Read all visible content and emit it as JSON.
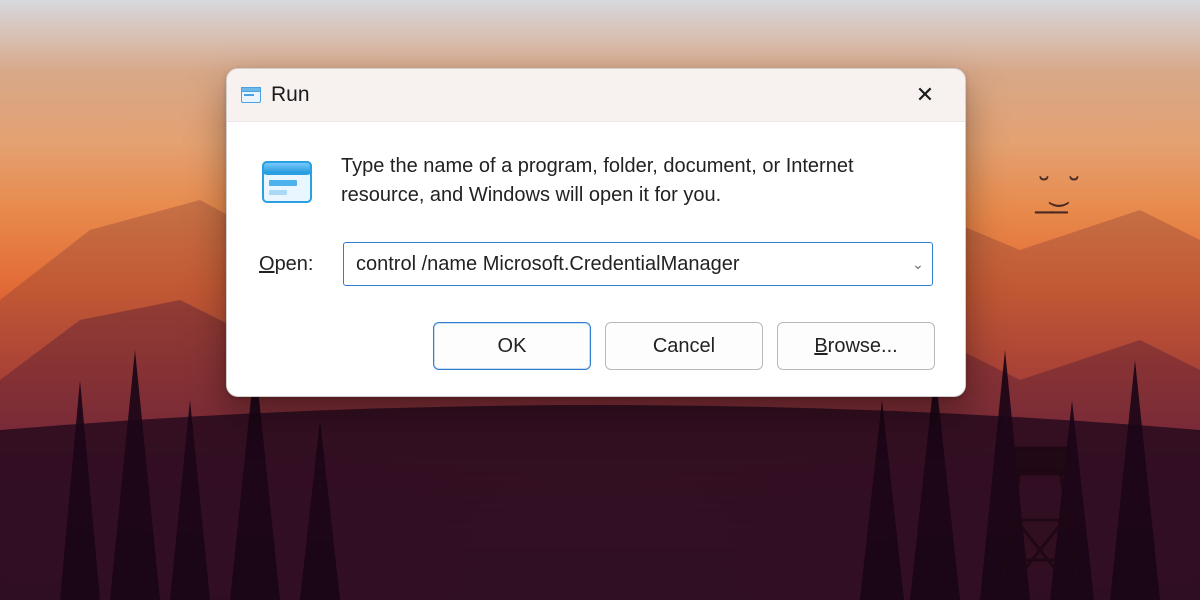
{
  "dialog": {
    "title": "Run",
    "description": "Type the name of a program, folder, document, or Internet resource, and Windows will open it for you.",
    "open_label_prefix": "O",
    "open_label_rest": "pen:",
    "command_value": "control /name Microsoft.CredentialManager",
    "buttons": {
      "ok": "OK",
      "cancel": "Cancel",
      "browse_prefix": "B",
      "browse_rest": "rowse..."
    }
  }
}
